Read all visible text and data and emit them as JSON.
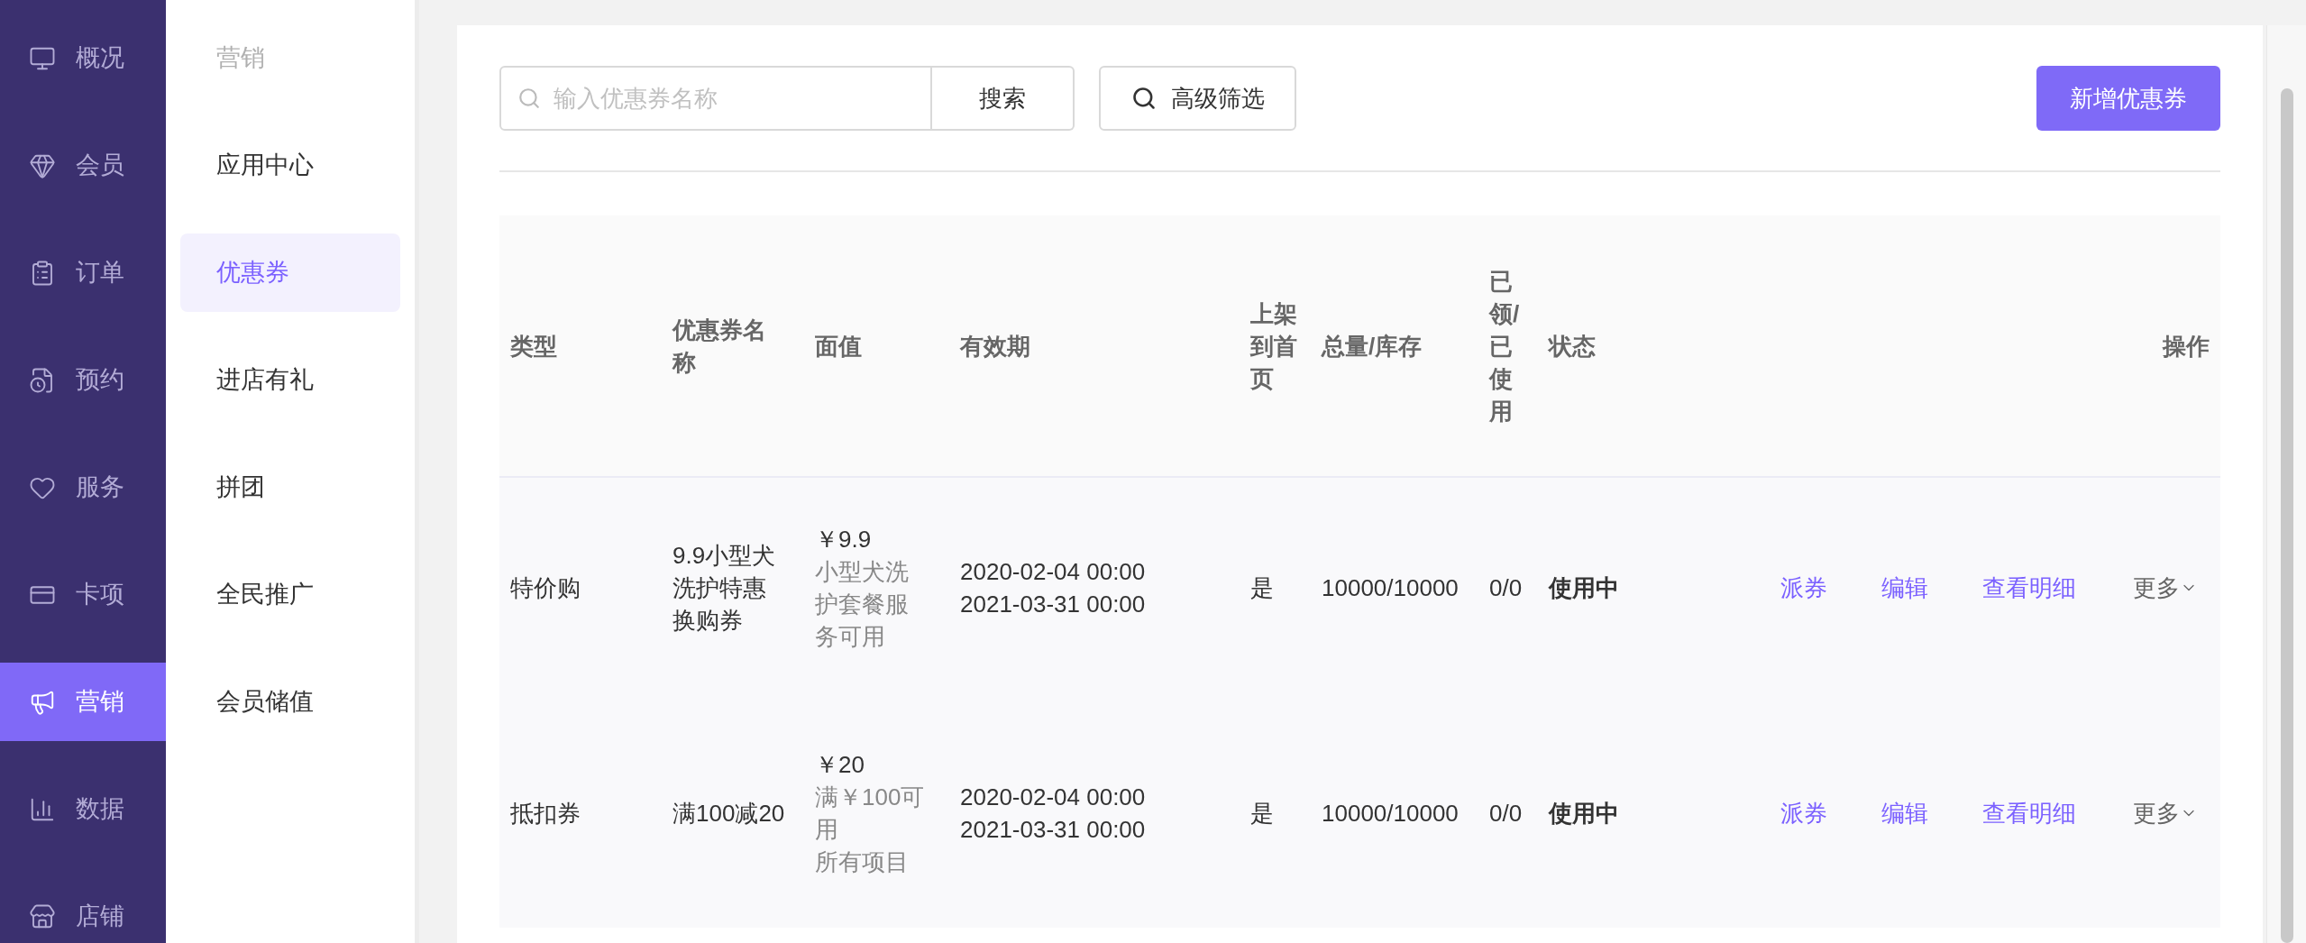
{
  "nav_rail": {
    "items": [
      {
        "label": "概况",
        "selected": false
      },
      {
        "label": "会员",
        "selected": false
      },
      {
        "label": "订单",
        "selected": false
      },
      {
        "label": "预约",
        "selected": false
      },
      {
        "label": "服务",
        "selected": false
      },
      {
        "label": "卡项",
        "selected": false
      },
      {
        "label": "营销",
        "selected": true
      },
      {
        "label": "数据",
        "selected": false
      },
      {
        "label": "店铺",
        "selected": false
      }
    ]
  },
  "submenu": {
    "title": "营销",
    "items": [
      {
        "label": "应用中心",
        "selected": false
      },
      {
        "label": "优惠券",
        "selected": true
      },
      {
        "label": "进店有礼",
        "selected": false
      },
      {
        "label": "拼团",
        "selected": false
      },
      {
        "label": "全民推广",
        "selected": false
      },
      {
        "label": "会员储值",
        "selected": false
      }
    ]
  },
  "toolbar": {
    "search": {
      "placeholder": "输入优惠券名称"
    },
    "search_button": "搜索",
    "filter_button": "高级筛选",
    "add_button": "新增优惠券"
  },
  "table": {
    "columns": [
      "类型",
      "优惠券名称",
      "面值",
      "有效期",
      "上架到首页",
      "总量/库存",
      "已领/已使用",
      "状态",
      "操作"
    ],
    "rows": [
      {
        "type": "特价购",
        "name": "9.9小型犬洗护特惠换购券",
        "face_value": "￥9.9",
        "face_notes": [
          "小型犬洗护套餐服务可用"
        ],
        "validity": [
          "2020-02-04 00:00",
          "2021-03-31 00:00"
        ],
        "on_homepage": "是",
        "total_stock": "10000/10000",
        "claimed_used": "0/0",
        "status": "使用中",
        "actions": [
          "派券",
          "编辑",
          "查看明细"
        ],
        "more": "更多"
      },
      {
        "type": "抵扣券",
        "name": "满100减20",
        "face_value": "￥20",
        "face_notes": [
          "满￥100可用",
          "所有项目"
        ],
        "validity": [
          "2020-02-04 00:00",
          "2021-03-31 00:00"
        ],
        "on_homepage": "是",
        "total_stock": "10000/10000",
        "claimed_used": "0/0",
        "status": "使用中",
        "actions": [
          "派券",
          "编辑",
          "查看明细"
        ],
        "more": "更多"
      }
    ]
  }
}
